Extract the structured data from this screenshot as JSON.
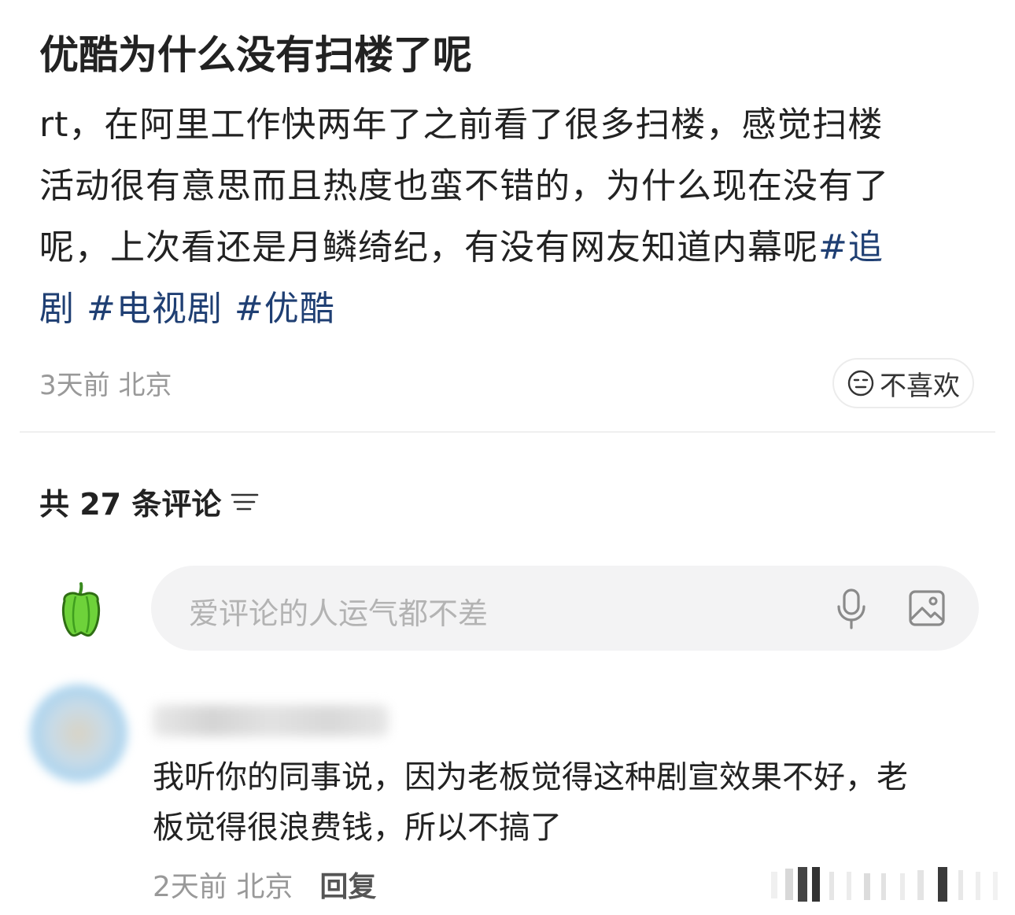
{
  "post": {
    "title": "优酷为什么没有扫楼了呢",
    "body_lines": [
      "rt，在阿里工作快两年了之前看了很多扫楼，感觉扫楼",
      "活动很有意思而且热度也蛮不错的，为什么现在没有了",
      "呢，上次看还是月鳞绮纪，有没有网友知道内幕呢"
    ],
    "hashtag_1a": "#追",
    "hashtag_1b": "剧",
    "hashtag_2": "#电视剧",
    "hashtag_3": "#优酷",
    "time": "3天前",
    "location": "北京",
    "dislike_label": "不喜欢",
    "dislike_icon": "neutral-face-icon"
  },
  "comments_section": {
    "count_label": "共 27 条评论",
    "sort_icon": "sort-lines-icon",
    "input_placeholder": "爱评论的人运气都不差",
    "avatar_icon": "green-pepper-icon",
    "mic_icon": "microphone-icon",
    "image_icon": "image-icon"
  },
  "comment": {
    "text_lines": [
      "我听你的同事说，因为老板觉得这种剧宣效果不好，老",
      "板觉得很浪费钱，所以不搞了"
    ],
    "time": "2天前",
    "location": "北京",
    "reply_label": "回复"
  },
  "colors": {
    "hashtag": "#1f3f73",
    "meta_gray": "#999999",
    "input_bg": "#f3f3f4",
    "pepper_green": "#6ed23a"
  }
}
